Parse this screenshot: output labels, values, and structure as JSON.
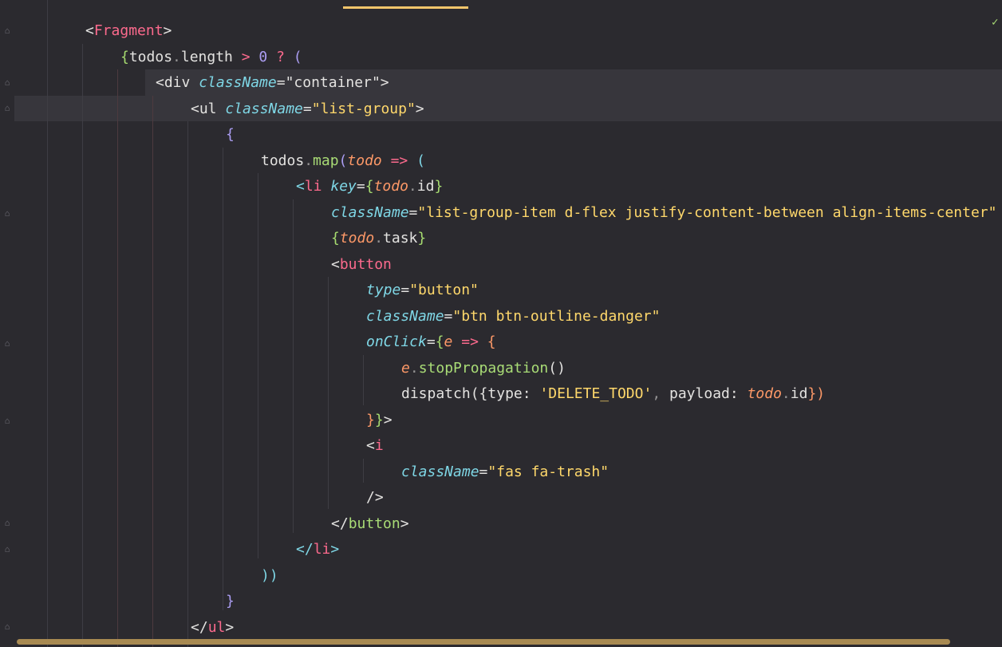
{
  "editor": {
    "status_check_icon": "checkmark-icon",
    "lines": [
      {
        "indent": 1,
        "tokens": [
          [
            "t-tag2",
            "<"
          ],
          [
            "t-tag",
            "Fragment"
          ],
          [
            "t-tag2",
            ">"
          ]
        ]
      },
      {
        "indent": 2,
        "tokens": [
          [
            "t-brace1",
            "{"
          ],
          [
            "t-tag2",
            "todos"
          ],
          [
            "t-punct",
            "."
          ],
          [
            "t-tag2",
            "length "
          ],
          [
            "t-op",
            ">"
          ],
          [
            "t-tag2",
            " "
          ],
          [
            "t-num",
            "0"
          ],
          [
            "t-tag2",
            " "
          ],
          [
            "t-op",
            "?"
          ],
          [
            "t-tag2",
            " "
          ],
          [
            "t-brace2",
            "("
          ]
        ]
      },
      {
        "indent": 3,
        "tokens": [
          [
            "t-tag2",
            "<div "
          ],
          [
            "t-attr",
            "className"
          ],
          [
            "t-tag2",
            "=\"container\">"
          ]
        ]
      },
      {
        "indent": 4,
        "tokens": [
          [
            "t-tag2",
            "<ul "
          ],
          [
            "t-attr",
            "className"
          ],
          [
            "t-tag2",
            "="
          ],
          [
            "t-str",
            "\"list-group\""
          ],
          [
            "t-tag2",
            ">"
          ]
        ]
      },
      {
        "indent": 5,
        "tokens": [
          [
            "t-brace2",
            "{"
          ]
        ]
      },
      {
        "indent": 6,
        "tokens": [
          [
            "t-tag2",
            "todos"
          ],
          [
            "t-punct",
            "."
          ],
          [
            "t-fn",
            "map"
          ],
          [
            "t-brace2",
            "("
          ],
          [
            "t-param",
            "todo"
          ],
          [
            "t-tag2",
            " "
          ],
          [
            "t-op",
            "=>"
          ],
          [
            "t-tag2",
            " "
          ],
          [
            "t-kw",
            "("
          ]
        ]
      },
      {
        "indent": 7,
        "tokens": [
          [
            "t-kw",
            "<"
          ],
          [
            "t-tag",
            "li "
          ],
          [
            "t-attr",
            "key"
          ],
          [
            "t-tag2",
            "="
          ],
          [
            "t-brace1",
            "{"
          ],
          [
            "t-param",
            "todo"
          ],
          [
            "t-punct",
            "."
          ],
          [
            "t-tag2",
            "id"
          ],
          [
            "t-brace1",
            "}"
          ]
        ]
      },
      {
        "indent": 8,
        "tokens": [
          [
            "t-attr",
            "className"
          ],
          [
            "t-tag2",
            "="
          ],
          [
            "t-str",
            "\"list-group-item d-flex justify-content-between align-items-center\""
          ]
        ]
      },
      {
        "indent": 8,
        "tokens": [
          [
            "t-brace1",
            "{"
          ],
          [
            "t-param",
            "todo"
          ],
          [
            "t-punct",
            "."
          ],
          [
            "t-tag2",
            "task"
          ],
          [
            "t-brace1",
            "}"
          ]
        ]
      },
      {
        "indent": 8,
        "tokens": [
          [
            "t-tag2",
            "<"
          ],
          [
            "t-tag",
            "button"
          ]
        ]
      },
      {
        "indent": 9,
        "tokens": [
          [
            "t-attr",
            "type"
          ],
          [
            "t-tag2",
            "="
          ],
          [
            "t-str",
            "\"button\""
          ]
        ]
      },
      {
        "indent": 9,
        "tokens": [
          [
            "t-attr",
            "className"
          ],
          [
            "t-tag2",
            "="
          ],
          [
            "t-str",
            "\"btn btn-outline-danger\""
          ]
        ]
      },
      {
        "indent": 9,
        "tokens": [
          [
            "t-attr",
            "onClick"
          ],
          [
            "t-tag2",
            "="
          ],
          [
            "t-brace1",
            "{"
          ],
          [
            "t-param",
            "e"
          ],
          [
            "t-tag2",
            " "
          ],
          [
            "t-op",
            "=>"
          ],
          [
            "t-tag2",
            " "
          ],
          [
            "t-brace3",
            "{"
          ]
        ]
      },
      {
        "indent": 10,
        "tokens": [
          [
            "t-param",
            "e"
          ],
          [
            "t-punct",
            "."
          ],
          [
            "t-fn",
            "stopPropagation"
          ],
          [
            "t-tag2",
            "()"
          ]
        ]
      },
      {
        "indent": 10,
        "tokens": [
          [
            "t-tag2",
            "dispatch"
          ],
          [
            "t-tag2",
            "({"
          ],
          [
            "t-tag2",
            "type"
          ],
          [
            "t-tag2",
            ": "
          ],
          [
            "t-str",
            "'DELETE_TODO'"
          ],
          [
            "t-punct",
            ","
          ],
          [
            "t-tag2",
            " payload"
          ],
          [
            "t-tag2",
            ": "
          ],
          [
            "t-param",
            "todo"
          ],
          [
            "t-punct",
            "."
          ],
          [
            "t-tag2",
            "id"
          ],
          [
            "t-brace3",
            "})"
          ]
        ]
      },
      {
        "indent": 9,
        "tokens": [
          [
            "t-brace3",
            "}"
          ],
          [
            "t-brace1",
            "}"
          ],
          [
            "t-tag2",
            ">"
          ]
        ]
      },
      {
        "indent": 9,
        "tokens": [
          [
            "t-tag2",
            "<"
          ],
          [
            "t-tag",
            "i"
          ]
        ]
      },
      {
        "indent": 10,
        "tokens": [
          [
            "t-attr",
            "className"
          ],
          [
            "t-tag2",
            "="
          ],
          [
            "t-str",
            "\"fas fa-trash\""
          ]
        ]
      },
      {
        "indent": 9,
        "tokens": [
          [
            "t-tag2",
            "/>"
          ]
        ]
      },
      {
        "indent": 8,
        "tokens": [
          [
            "t-tag2",
            "</"
          ],
          [
            "t-fn",
            "button"
          ],
          [
            "t-tag2",
            ">"
          ]
        ]
      },
      {
        "indent": 7,
        "tokens": [
          [
            "t-kw",
            "</"
          ],
          [
            "t-tag",
            "li"
          ],
          [
            "t-kw",
            ">"
          ]
        ]
      },
      {
        "indent": 6,
        "tokens": [
          [
            "t-kw",
            "))"
          ]
        ]
      },
      {
        "indent": 5,
        "tokens": [
          [
            "t-brace2",
            "}"
          ]
        ]
      },
      {
        "indent": 4,
        "tokens": [
          [
            "t-tag2",
            "</"
          ],
          [
            "t-tag",
            "ul"
          ],
          [
            "t-tag2",
            ">"
          ]
        ]
      }
    ]
  }
}
